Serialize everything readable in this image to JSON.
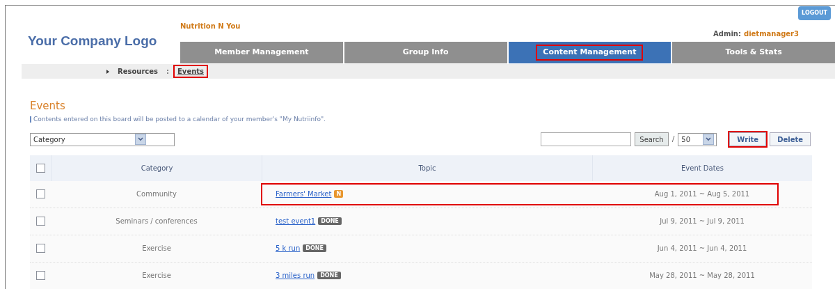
{
  "header": {
    "logo": "Your Company Logo",
    "site_name": "Nutrition N You",
    "admin_label": "Admin:",
    "admin_user": "dietmanager3",
    "logout": "LOGOUT"
  },
  "tabs": [
    {
      "label": "Member Management",
      "selected": false,
      "highlighted": false
    },
    {
      "label": "Group Info",
      "selected": false,
      "highlighted": false
    },
    {
      "label": "Content Management",
      "selected": true,
      "highlighted": true
    },
    {
      "label": "Tools & Stats",
      "selected": false,
      "highlighted": false
    }
  ],
  "breadcrumb": [
    {
      "label": "Resources",
      "highlighted": false
    },
    {
      "label": "Events",
      "highlighted": true
    }
  ],
  "breadcrumb_separator": ":",
  "page": {
    "title": "Events",
    "description": "Contents entered on this board will be posted to a calendar of your member's \"My Nutriinfo\"."
  },
  "toolbar": {
    "category_select": "Category",
    "search_button": "Search",
    "page_separator": "/",
    "per_page": "50",
    "buttons": [
      {
        "label": "Write",
        "highlighted": true
      },
      {
        "label": "Delete",
        "highlighted": false
      }
    ]
  },
  "table": {
    "columns": [
      "Category",
      "Topic",
      "Event Dates"
    ],
    "header_checked": false,
    "rows": [
      {
        "checked": false,
        "highlighted": true,
        "category": "Community",
        "topic": "Farmers' Market",
        "badge": {
          "kind": "new",
          "text": "N"
        },
        "dates": "Aug 1, 2011 ~ Aug 5, 2011"
      },
      {
        "checked": false,
        "highlighted": false,
        "category": "Seminars / conferences",
        "topic": "test event1",
        "badge": {
          "kind": "done",
          "text": "DONE"
        },
        "dates": "Jul 9, 2011 ~ Jul 9, 2011"
      },
      {
        "checked": false,
        "highlighted": false,
        "category": "Exercise",
        "topic": "5 k run",
        "badge": {
          "kind": "done",
          "text": "DONE"
        },
        "dates": "Jun 4, 2011 ~ Jun 4, 2011"
      },
      {
        "checked": false,
        "highlighted": false,
        "category": "Exercise",
        "topic": "3 miles run",
        "badge": {
          "kind": "done",
          "text": "DONE"
        },
        "dates": "May 28, 2011 ~ May 28, 2011"
      }
    ]
  }
}
